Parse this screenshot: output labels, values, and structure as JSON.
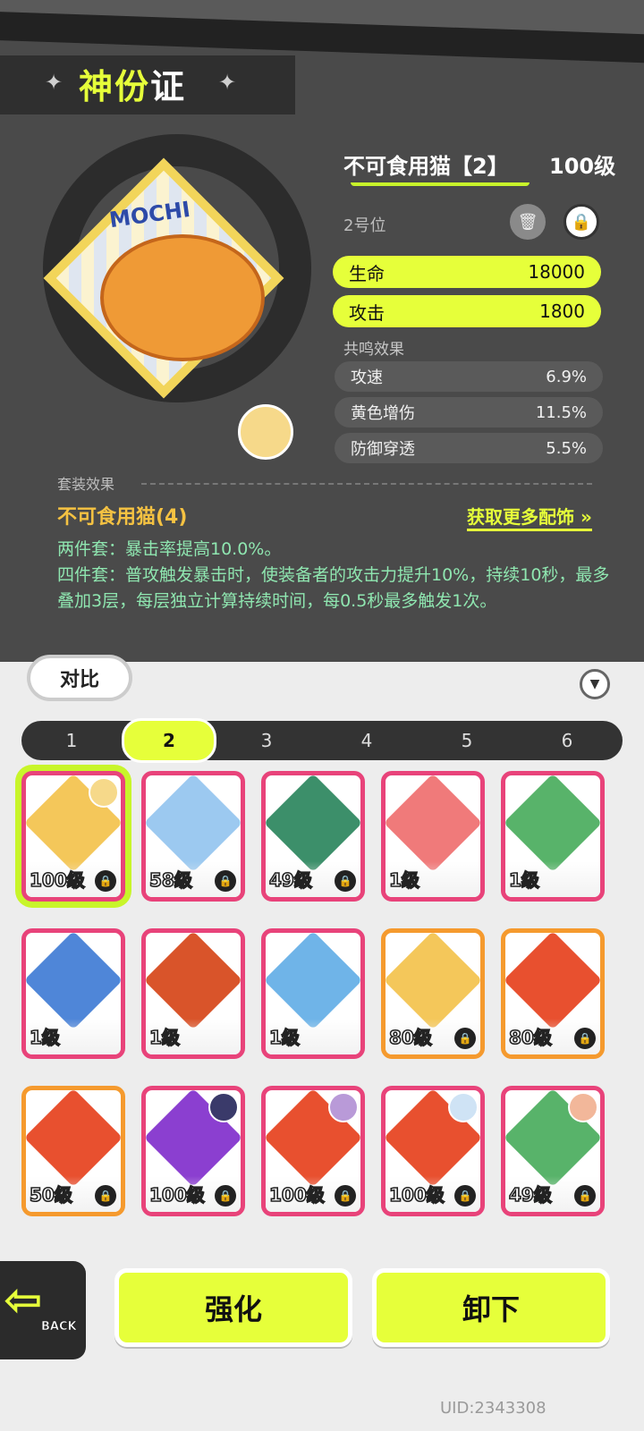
{
  "header": {
    "title_yellow": "神份",
    "title_white": "证"
  },
  "equip": {
    "name": "不可食用猫【2】",
    "level": "100级",
    "slot": "2号位",
    "card_text": "MOCHI",
    "stats_main": [
      {
        "label": "生命",
        "value": "18000"
      },
      {
        "label": "攻击",
        "value": "1800"
      }
    ],
    "resonance_label": "共鸣效果",
    "stats_sub": [
      {
        "label": "攻速",
        "value": "6.9%"
      },
      {
        "label": "黄色增伤",
        "value": "11.5%"
      },
      {
        "label": "防御穿透",
        "value": "5.5%"
      }
    ]
  },
  "set": {
    "label": "套装效果",
    "name": "不可食用猫(4)",
    "more_link": "获取更多配饰 »",
    "two_piece": "两件套：暴击率提高10.0%。",
    "four_piece": "四件套：普攻触发暴击时，使装备者的攻击力提升10%，持续10秒，最多叠加3层，每层独立计算持续时间，每0.5秒最多触发1次。"
  },
  "controls": {
    "compare": "对比",
    "filter_icon": "filter-icon"
  },
  "tabs": [
    "1",
    "2",
    "3",
    "4",
    "5",
    "6"
  ],
  "active_tab": "2",
  "items": [
    {
      "level": "100级",
      "lock": true,
      "owner": true,
      "art": "mochi-cat",
      "selected": true
    },
    {
      "level": "58级",
      "lock": true,
      "owner": false,
      "art": "blue-bird"
    },
    {
      "level": "49级",
      "lock": true,
      "owner": false,
      "art": "green-ghost"
    },
    {
      "level": "1级",
      "lock": false,
      "owner": false,
      "art": "red-wizard"
    },
    {
      "level": "1级",
      "lock": false,
      "owner": false,
      "art": "green-graffiti"
    },
    {
      "level": "1级",
      "lock": false,
      "owner": false,
      "art": "blue-cats"
    },
    {
      "level": "1级",
      "lock": false,
      "owner": false,
      "art": "gold-statue"
    },
    {
      "level": "1级",
      "lock": false,
      "owner": false,
      "art": "pufferfish"
    },
    {
      "level": "80级",
      "lock": true,
      "owner": false,
      "art": "mochi-cat"
    },
    {
      "level": "80级",
      "lock": true,
      "owner": false,
      "art": "red-graffiti-cat"
    },
    {
      "level": "50级",
      "lock": true,
      "owner": false,
      "art": "red-graffiti-cat"
    },
    {
      "level": "100级",
      "lock": true,
      "owner": true,
      "art": "purple-silhouette"
    },
    {
      "level": "100级",
      "lock": true,
      "owner": true,
      "art": "red-graffiti-cat"
    },
    {
      "level": "100级",
      "lock": true,
      "owner": true,
      "art": "red-graffiti-cat"
    },
    {
      "level": "49级",
      "lock": true,
      "owner": true,
      "art": "green-graffiti"
    }
  ],
  "buttons": {
    "back": "BACK",
    "upgrade": "强化",
    "unequip": "卸下"
  },
  "uid": "UID:2343308",
  "colors": {
    "accent": "#e6ff3a",
    "rare_border": "#e8437a",
    "epic_border": "#f59a2e",
    "dark": "#4a4a4a"
  }
}
